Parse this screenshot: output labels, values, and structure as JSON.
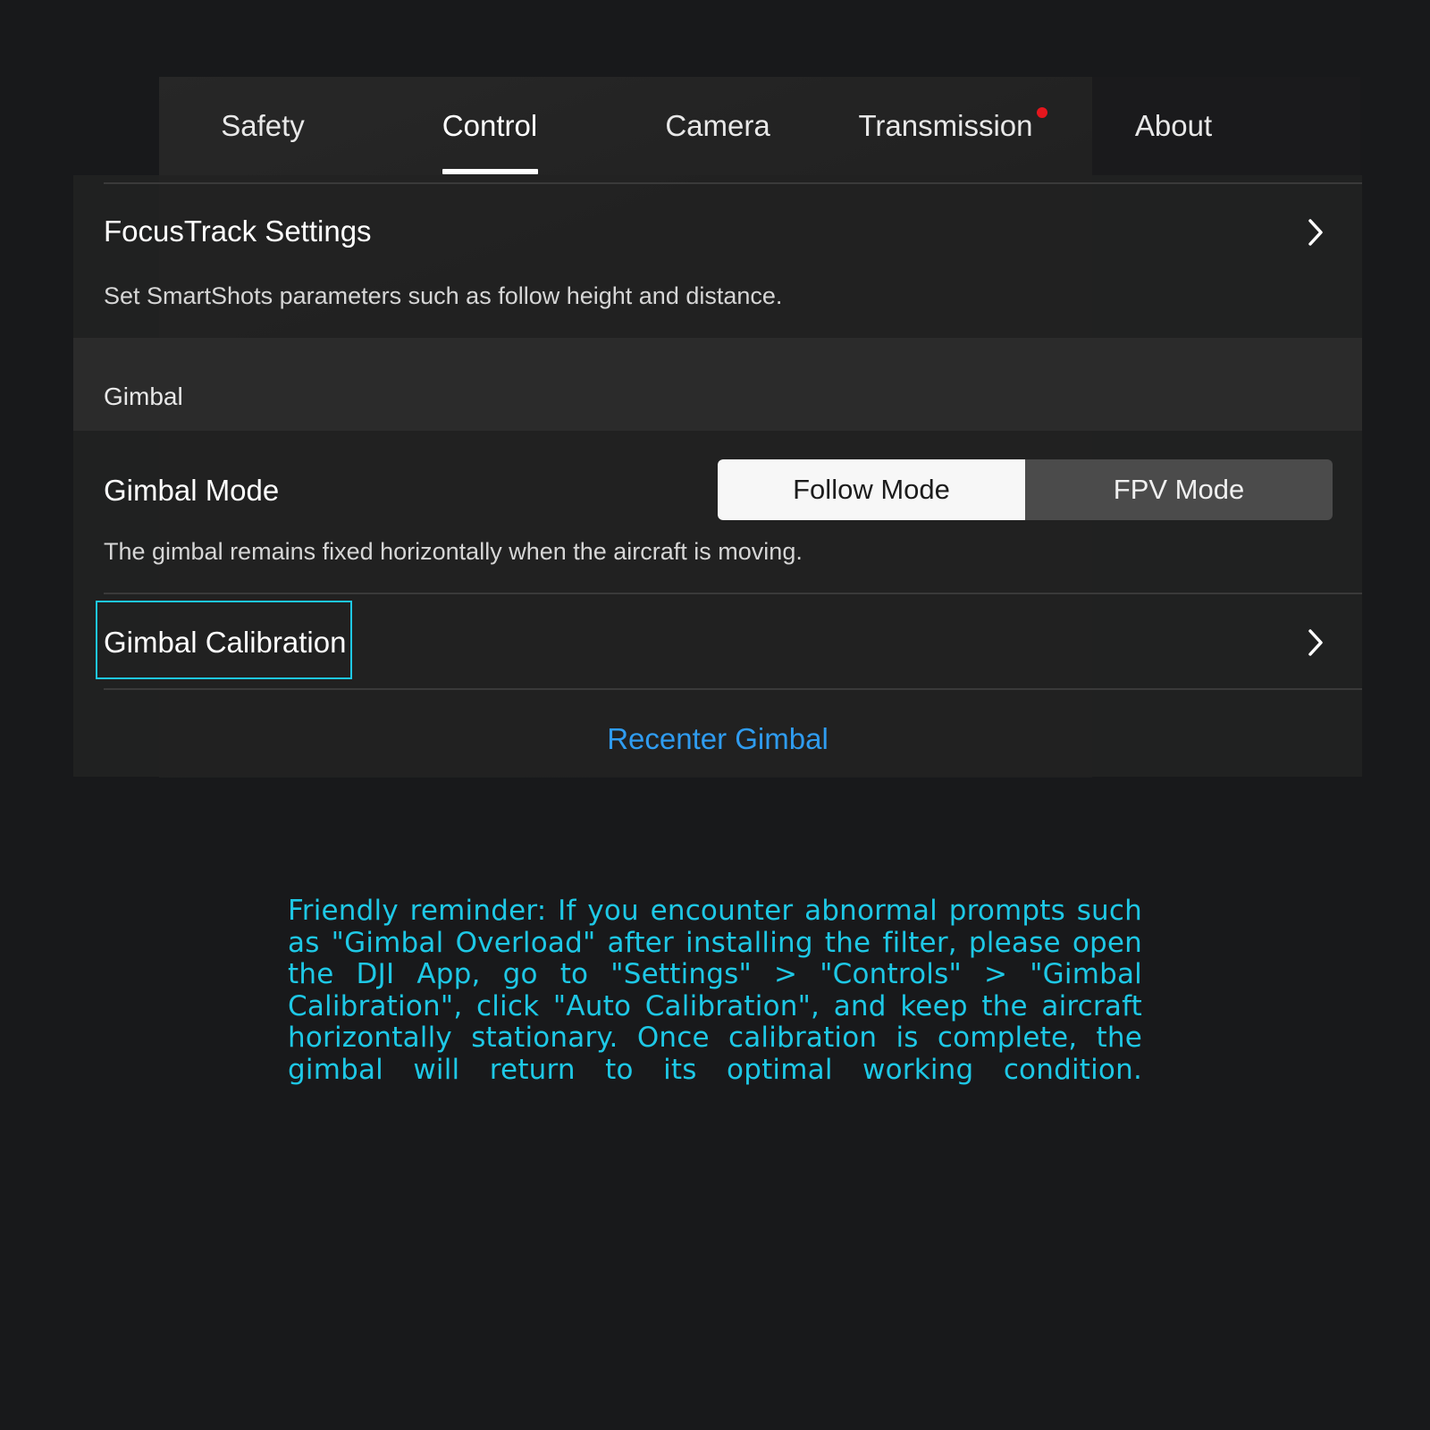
{
  "tabs": {
    "items": [
      {
        "label": "Safety"
      },
      {
        "label": "Control"
      },
      {
        "label": "Camera"
      },
      {
        "label": "Transmission"
      },
      {
        "label": "About"
      }
    ],
    "active": "Control"
  },
  "focustrack": {
    "title": "FocusTrack Settings",
    "description": "Set SmartShots parameters such as follow height and distance."
  },
  "gimbal_section": {
    "label": "Gimbal"
  },
  "gimbal_mode": {
    "title": "Gimbal Mode",
    "options": [
      "Follow Mode",
      "FPV Mode"
    ],
    "selected": "Follow Mode",
    "description": "The gimbal remains fixed horizontally when the aircraft is moving."
  },
  "gimbal_calibration": {
    "title": "Gimbal Calibration"
  },
  "recenter": {
    "label": "Recenter Gimbal"
  },
  "reminder": {
    "text": "Friendly reminder: If you encounter abnormal prompts such as \"Gimbal Overload\" after installing the filter, please open the DJI App, go to \"Settings\" > \"Controls\" > \"Gimbal Calibration\", click \"Auto Calibration\", and keep the aircraft horizontally stationary. Once calibration is complete, the gimbal will return to its optimal working condition."
  },
  "colors": {
    "accent_link": "#2f9cf0",
    "highlight_cyan": "#1ec8e6",
    "notification_dot": "#e5161d",
    "background": "#18191b"
  },
  "icons": {
    "row_chevron": "chevron-right-icon"
  }
}
